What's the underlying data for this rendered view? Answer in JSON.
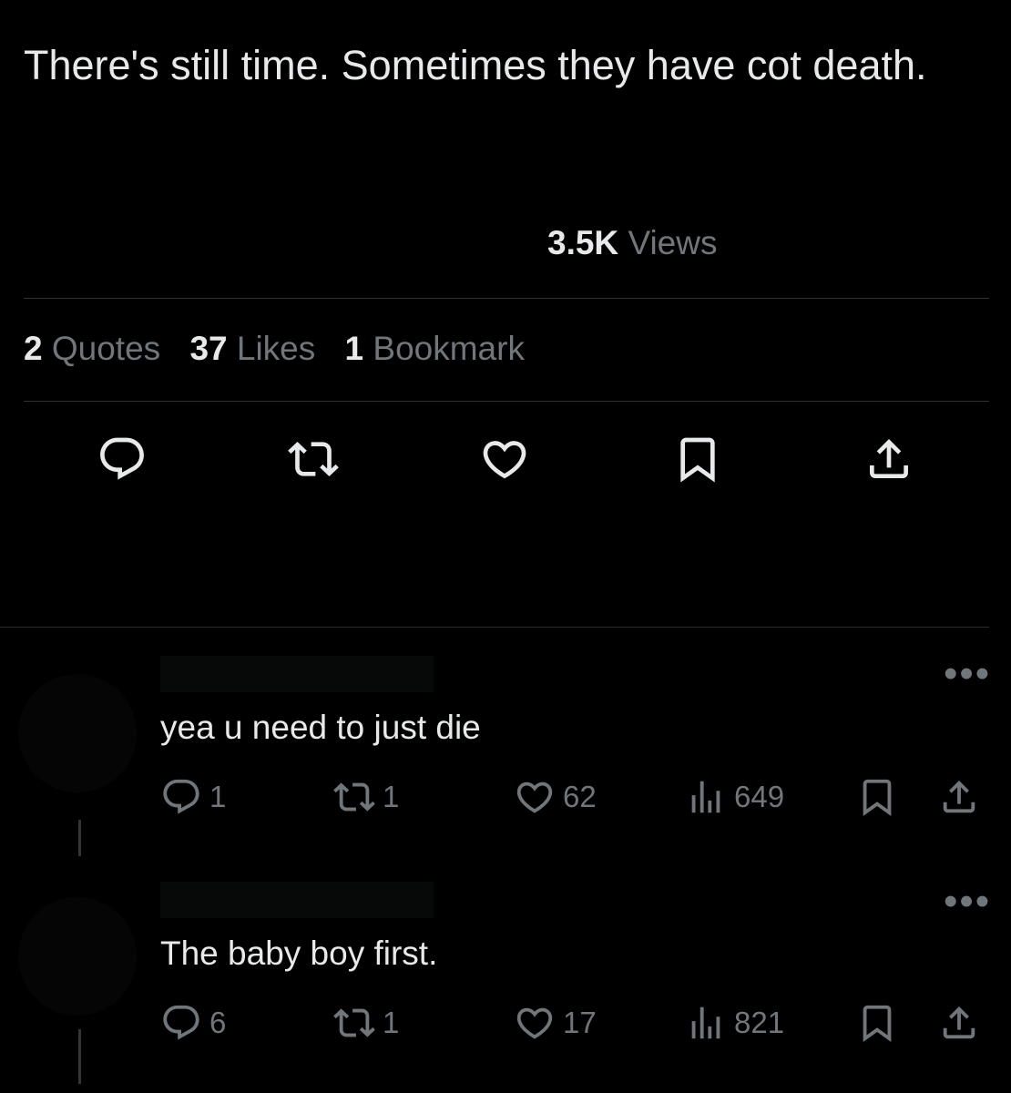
{
  "tweet": {
    "text": "There's still time. Sometimes they have cot death.",
    "views_count": "3.5K",
    "views_label": "Views"
  },
  "stats": {
    "quotes_count": "2",
    "quotes_label": "Quotes",
    "likes_count": "37",
    "likes_label": "Likes",
    "bookmarks_count": "1",
    "bookmarks_label": "Bookmark"
  },
  "actions": [
    "reply-icon",
    "repost-icon",
    "like-icon",
    "bookmark-icon",
    "share-icon"
  ],
  "replies": [
    {
      "text": "yea u need to just die",
      "reply_count": "1",
      "repost_count": "1",
      "like_count": "62",
      "view_count": "649"
    },
    {
      "text": "The baby boy first.",
      "reply_count": "6",
      "repost_count": "1",
      "like_count": "17",
      "view_count": "821"
    }
  ],
  "colors": {
    "background": "#000000",
    "text": "#e7e9ea",
    "muted": "#71767b",
    "divider": "#2f3336"
  }
}
